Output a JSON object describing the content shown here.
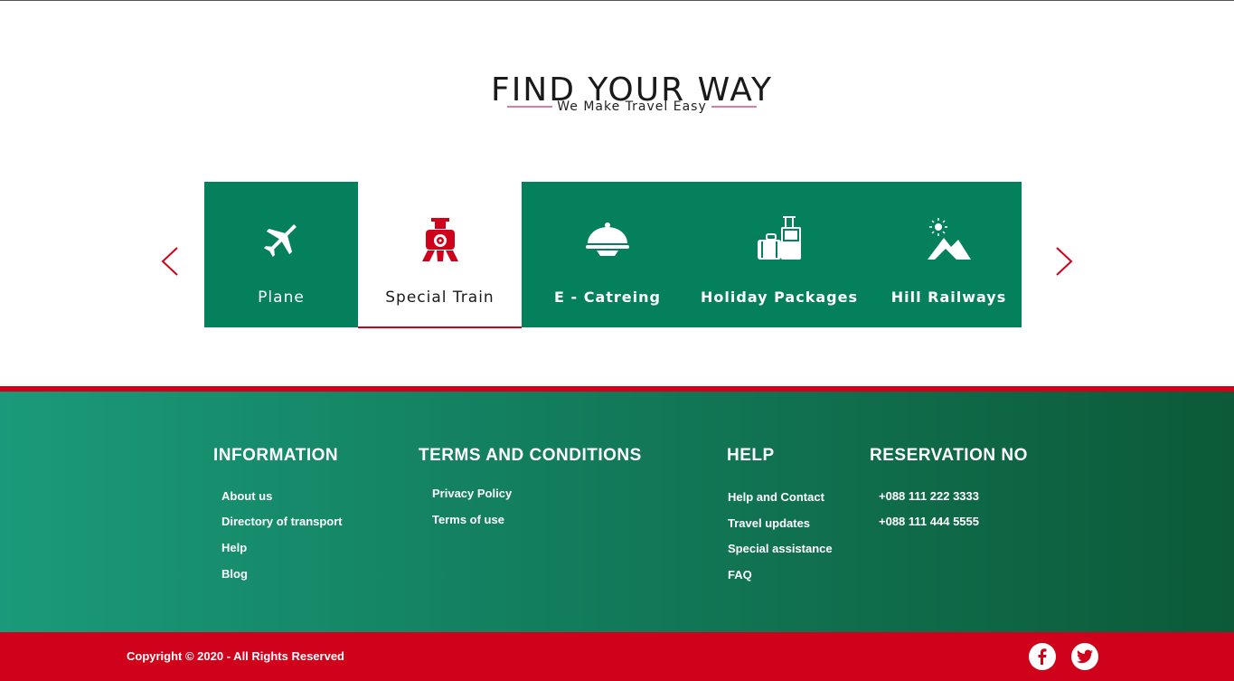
{
  "header": {
    "title": "FIND YOUR WAY",
    "subtitle": "We Make Travel Easy"
  },
  "services": {
    "items": [
      {
        "label": "Plane",
        "icon": "airplane-icon"
      },
      {
        "label": "Special Train",
        "icon": "train-icon",
        "active": true
      },
      {
        "label": "E - Catreing",
        "icon": "food-cloche-icon"
      },
      {
        "label": "Holiday Packages",
        "icon": "luggage-icon"
      },
      {
        "label": "Hill Railways",
        "icon": "mountain-icon"
      }
    ],
    "prev_icon": "chevron-left-icon",
    "next_icon": "chevron-right-icon"
  },
  "footer": {
    "information": {
      "heading": "INFORMATION",
      "links": [
        "About us",
        "Directory of transport",
        "Help",
        "Blog"
      ]
    },
    "terms": {
      "heading": "TERMS AND CONDITIONS",
      "links": [
        "Privacy Policy",
        "Terms of use"
      ]
    },
    "help": {
      "heading": "HELP",
      "links": [
        "Help and Contact",
        "Travel updates",
        "Special assistance",
        "FAQ"
      ]
    },
    "reservation": {
      "heading": "RESERVATION NO",
      "numbers": [
        "+088 111 222 3333",
        "+088 111 444 5555"
      ]
    },
    "copyright": "Copyright © 2020 - All Rights Reserved",
    "social": [
      "facebook-icon",
      "twitter-icon"
    ]
  },
  "colors": {
    "brand_green": "#05805d",
    "brand_red": "#d0021b",
    "accent_pink": "#e37aa0"
  }
}
